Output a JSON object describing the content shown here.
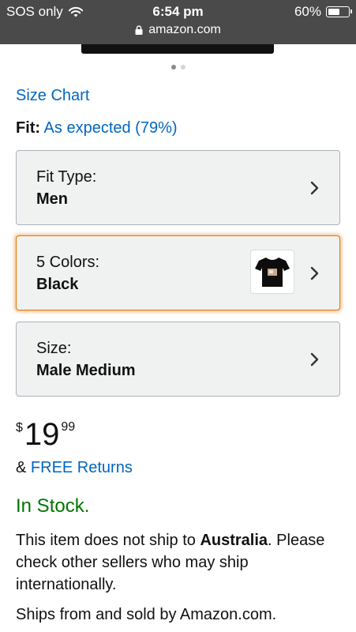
{
  "status_bar": {
    "carrier": "SOS only",
    "time": "6:54 pm",
    "battery_percent": "60%",
    "battery_level": 0.6,
    "url": "amazon.com"
  },
  "gallery": {
    "page_count": 2,
    "active_page": 1
  },
  "size_chart_link": "Size Chart",
  "fit": {
    "label": "Fit:",
    "value": "As expected (79%)"
  },
  "selectors": [
    {
      "label": "Fit Type:",
      "value": "Men",
      "has_thumbnail": false
    },
    {
      "label": "5 Colors:",
      "value": "Black",
      "has_thumbnail": true,
      "thumbnail_icon": "black-tshirt-icon"
    },
    {
      "label": "Size:",
      "value": "Male Medium",
      "has_thumbnail": false
    }
  ],
  "price": {
    "symbol": "$",
    "whole": "19",
    "fraction": "99"
  },
  "returns": {
    "prefix": "&",
    "link": "FREE Returns"
  },
  "stock_status": "In Stock.",
  "shipping": {
    "pre": "This item does not ship to ",
    "country": "Australia",
    "post": ". Please check other sellers who may ship internationally."
  },
  "sold_by": "Ships from and sold by Amazon.com.",
  "colors": {
    "link": "#0066c0",
    "in_stock": "#007600",
    "selected_border": "#e77600",
    "status_bar_bg": "#4a4a4a"
  }
}
